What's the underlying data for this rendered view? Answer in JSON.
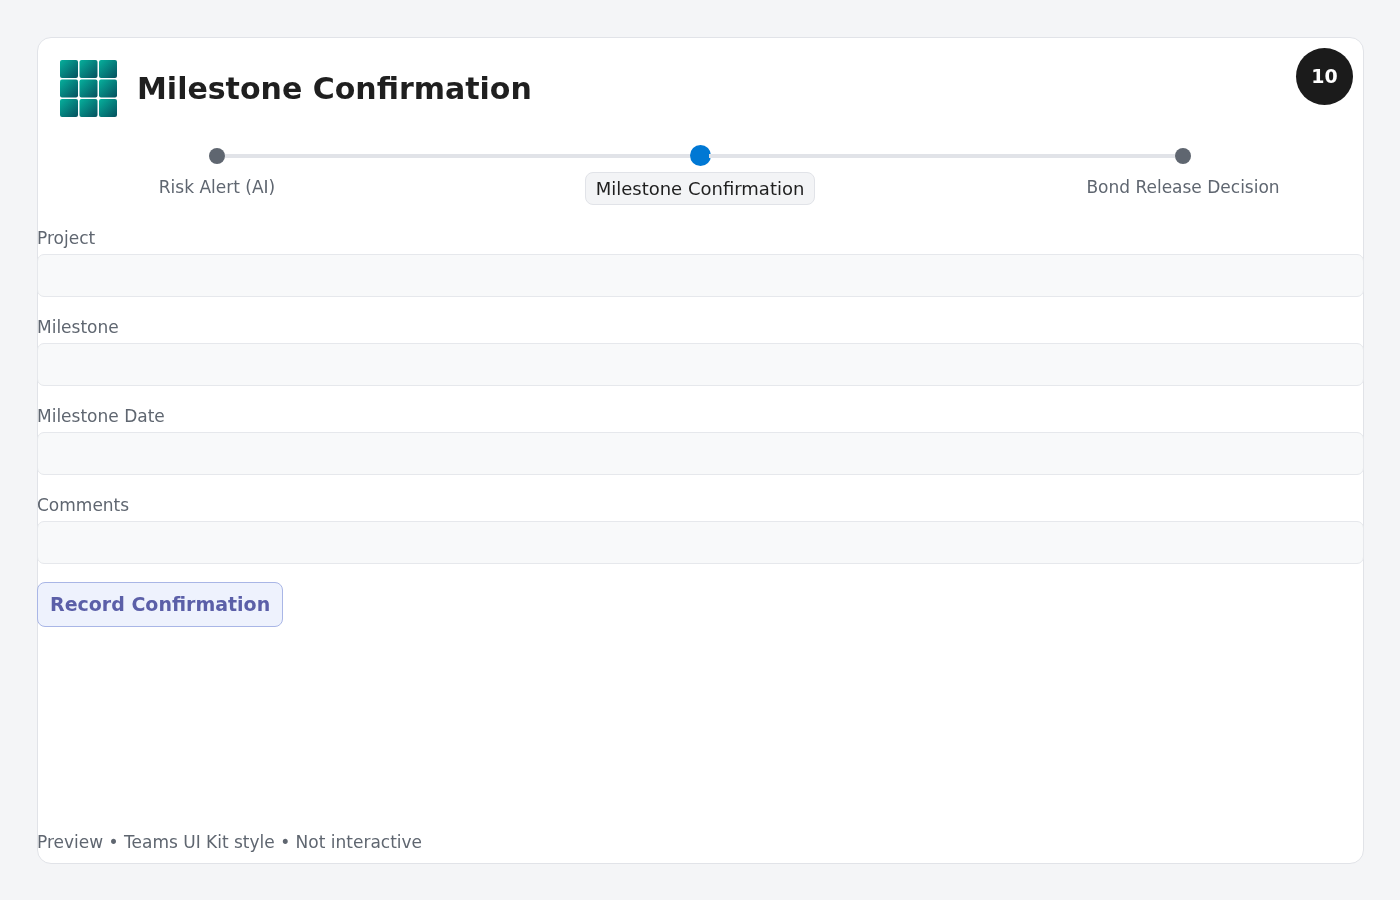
{
  "title": "Milestone Confirmation",
  "badge": "10",
  "steps": [
    {
      "label": "Risk Alert (AI)",
      "selected": false
    },
    {
      "label": "Milestone Confirmation",
      "selected": true
    },
    {
      "label": "Bond Release Decision",
      "selected": false
    }
  ],
  "fields": [
    {
      "label": "Project"
    },
    {
      "label": "Milestone"
    },
    {
      "label": "Milestone Date"
    },
    {
      "label": "Comments"
    }
  ],
  "button": "Record Confirmation",
  "footer": "Preview • Teams UI Kit style • Not interactive"
}
